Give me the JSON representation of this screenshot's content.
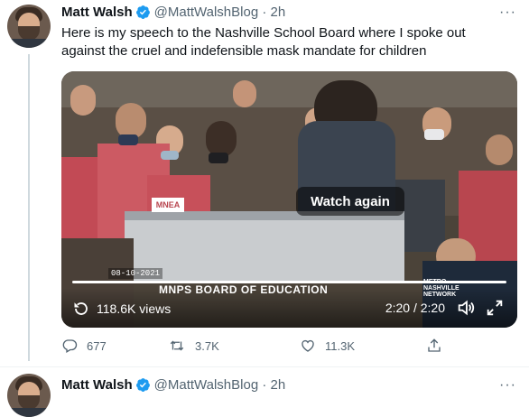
{
  "tweet1": {
    "author_name": "Matt Walsh",
    "handle_time": "@MattWalshBlog · 2h",
    "text": "Here is my speech to the Nashville School Board where I spoke out against the cruel and indefensible mask mandate for children",
    "more_label": "···",
    "media": {
      "overlay_button": "Watch again",
      "date_overlay": "08-10-2021",
      "banner_text": "MNPS BOARD OF EDUCATION",
      "views": "118.6K views",
      "time": "2:20 / 2:20",
      "sign_text": "MNEA",
      "logo_line1": "METRO",
      "logo_line2": "NASHVILLE",
      "logo_line3": "NETWORK",
      "progress_fraction": 1.0
    },
    "actions": {
      "replies": "677",
      "retweets": "3.7K",
      "likes": "11.3K"
    },
    "icons": [
      "reply-icon",
      "retweet-icon",
      "like-icon",
      "share-icon",
      "verified-icon",
      "replay-icon",
      "volume-icon",
      "fullscreen-icon"
    ]
  },
  "tweet2": {
    "author_name": "Matt Walsh",
    "handle_time": "@MattWalshBlog · 2h",
    "more_label": "···"
  },
  "colors": {
    "verified": "#1d9bf0",
    "secondary_text": "#536471",
    "thread_line": "#cfd9de"
  }
}
